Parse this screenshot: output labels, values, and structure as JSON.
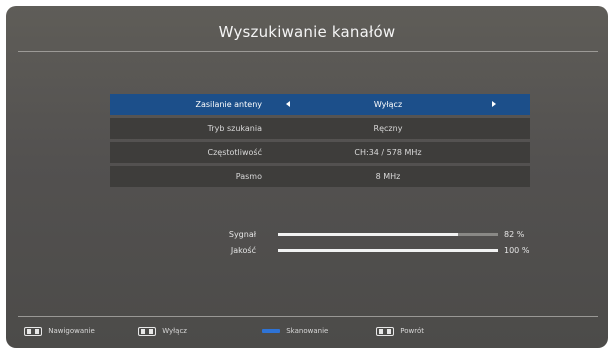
{
  "screen": {
    "title": "Wyszukiwanie kanałów"
  },
  "menu": {
    "rows": [
      {
        "label": "Zasilanie anteny",
        "value": "Wyłącz",
        "selected": true
      },
      {
        "label": "Tryb szukania",
        "value": "Ręczny"
      },
      {
        "label": "Częstotliwość",
        "value": "CH:34 / 578 MHz"
      },
      {
        "label": "Pasmo",
        "value": "8 MHz"
      }
    ]
  },
  "meters": [
    {
      "label": "Sygnał",
      "percent": 82,
      "percent_text": "82 %"
    },
    {
      "label": "Jakość",
      "percent": 100,
      "percent_text": "100 %"
    }
  ],
  "footer": {
    "items": [
      {
        "icon": "ok-keypad-icon",
        "label": "Nawigowanie"
      },
      {
        "icon": "exit-keypad-icon",
        "label": "Wyłącz"
      },
      {
        "icon": "blue-key-icon",
        "label": "Skanowanie"
      },
      {
        "icon": "back-keypad-icon",
        "label": "Powrót"
      }
    ]
  },
  "colors": {
    "selected": "#1c4f8a",
    "blue_key": "#2e73d6"
  }
}
